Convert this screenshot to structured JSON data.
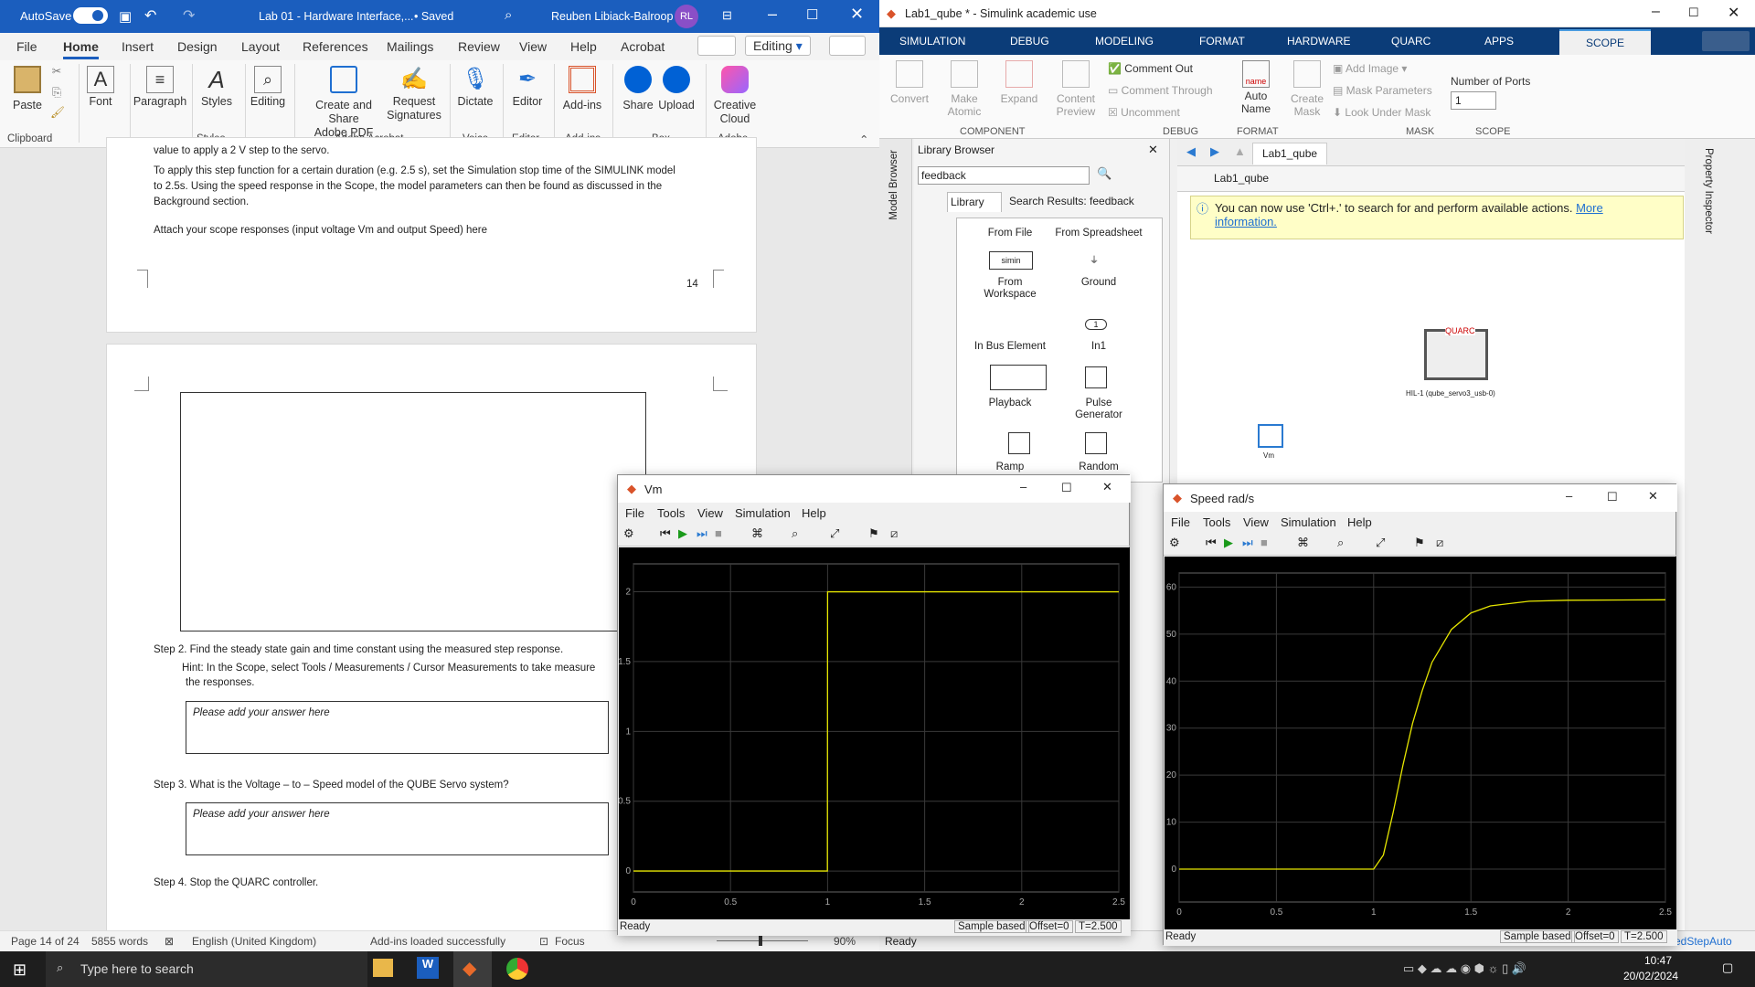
{
  "word": {
    "autosave": "AutoSave",
    "title": "Lab 01 - Hardware Interface,...",
    "saved": "• Saved",
    "user": "Reuben Libiack-Balroop",
    "avatar": "RL",
    "tabs": [
      "File",
      "Home",
      "Insert",
      "Design",
      "Layout",
      "References",
      "Mailings",
      "Review",
      "View",
      "Help",
      "Acrobat"
    ],
    "editing": "Editing",
    "ribbon": {
      "paste": "Paste",
      "font": "Font",
      "paragraph": "Paragraph",
      "styles": "Styles",
      "editing": "Editing",
      "create_pdf": "Create and Share\nAdobe PDF",
      "request_sig": "Request\nSignatures",
      "dictate": "Dictate",
      "editor": "Editor",
      "addins": "Add-ins",
      "share": "Share",
      "upload": "Upload",
      "creative": "Creative\nCloud"
    },
    "groups": {
      "clipboard": "Clipboard",
      "styles": "Styles",
      "acrobat": "Adobe Acrobat",
      "voice": "Voice",
      "editor": "Editor",
      "addins": "Add-ins",
      "box": "Box",
      "adobe": "Adobe"
    },
    "doc": {
      "l1": "value to apply a 2 V step to the servo.",
      "l2": "To apply this step function for a certain duration (e.g.  2.5 s), set the Simulation stop time of the SIMULINK model",
      "l3": "to 2.5s.  Using the speed response in the Scope, the model parameters can then be found as discussed in the",
      "l4": "Background section.",
      "l5": "Attach your scope responses (input voltage Vm and output Speed) here",
      "page_no": "14",
      "step2": "Step 2.  Find the steady state gain and time constant using the measured step response.",
      "hint": "Hint: In the Scope, select Tools / Measurements / Cursor Measurements to take measure",
      "hint2": "the responses.",
      "answer1": "Please add your answer here",
      "step3": "Step 3.  What is the Voltage – to – Speed model of the QUBE Servo system?",
      "answer2": "Please add your answer here",
      "step4": "Step 4.  Stop the QUARC controller."
    },
    "status": {
      "page": "Page 14 of 24",
      "words": "5855 words",
      "lang": "English (United Kingdom)",
      "addins": "Add-ins loaded successfully",
      "focus": "Focus",
      "zoom": "90%"
    }
  },
  "simulink": {
    "title": "Lab1_qube * - Simulink academic use",
    "tabs": [
      "SIMULATION",
      "DEBUG",
      "MODELING",
      "FORMAT",
      "HARDWARE",
      "QUARC",
      "APPS",
      "SCOPE"
    ],
    "ribbon": {
      "convert": "Convert",
      "make_atomic": "Make\nAtomic",
      "expand": "Expand",
      "content_preview": "Content\nPreview",
      "comment_out": "Comment Out",
      "comment_through": "Comment Through",
      "uncomment": "Uncomment",
      "auto_name": "Auto\nName",
      "create_mask": "Create\nMask",
      "add_image": "Add Image",
      "mask_params": "Mask Parameters",
      "look_under": "Look Under Mask",
      "num_ports": "Number of Ports",
      "ports_value": "1"
    },
    "groups": [
      "COMPONENT",
      "DEBUG",
      "FORMAT",
      "MASK",
      "SCOPE"
    ],
    "library": {
      "title": "Library Browser",
      "search": "feedback",
      "tab1": "Library",
      "tab2": "Search Results: feedback",
      "blocks": [
        "From File",
        "From Spreadsheet",
        "From\nWorkspace",
        "Ground",
        "In Bus Element",
        "In1",
        "Playback",
        "Pulse\nGenerator",
        "Ramp",
        "Random"
      ],
      "simin": "simin"
    },
    "model": {
      "tab": "Lab1_qube",
      "path": "Lab1_qube",
      "info": "You can now use 'Ctrl+.' to search for and perform available actions.",
      "info_link": "More information.",
      "hil": "HIL-1 (qube_servo3_usb-0)",
      "hil_logo": "QUARC",
      "vm": "Vm",
      "side": "Model Browser",
      "inspector": "Property Inspector"
    },
    "status": {
      "ready": "Ready",
      "solver": "edStepAuto"
    }
  },
  "scopes": [
    {
      "title": "Vm",
      "menu": [
        "File",
        "Tools",
        "View",
        "Simulation",
        "Help"
      ],
      "status": "Ready",
      "sample": "Sample based",
      "offset": "Offset=0",
      "time": "T=2.500"
    },
    {
      "title": "Speed rad/s",
      "menu": [
        "File",
        "Tools",
        "View",
        "Simulation",
        "Help"
      ],
      "status": "Ready",
      "sample": "Sample based",
      "offset": "Offset=0",
      "time": "T=2.500"
    }
  ],
  "chart_data": [
    {
      "type": "line",
      "title": "Vm",
      "x": [
        0,
        0.999,
        1.0,
        2.5
      ],
      "series": [
        {
          "values": [
            0,
            0,
            2,
            2
          ]
        }
      ],
      "xlim": [
        0,
        2.5
      ],
      "ylim": [
        -0.15,
        2.2
      ],
      "xticks": [
        "0",
        "0.5",
        "1",
        "1.5",
        "2",
        "2.5"
      ],
      "yticks": [
        "0",
        "0.5",
        "1",
        "1.5",
        "2"
      ],
      "grid": true,
      "line_color": "#e6e600"
    },
    {
      "type": "line",
      "title": "Speed rad/s",
      "x": [
        0,
        1.0,
        1.05,
        1.1,
        1.15,
        1.2,
        1.25,
        1.3,
        1.4,
        1.5,
        1.6,
        1.8,
        2.0,
        2.5
      ],
      "series": [
        {
          "values": [
            0,
            0,
            3,
            12,
            22,
            31,
            38,
            44,
            51,
            54.5,
            56,
            57,
            57.2,
            57.3
          ]
        }
      ],
      "xlim": [
        0,
        2.5
      ],
      "ylim": [
        -7,
        63
      ],
      "xticks": [
        "0",
        "0.5",
        "1",
        "1.5",
        "2",
        "2.5"
      ],
      "yticks": [
        "0",
        "10",
        "20",
        "30",
        "40",
        "50",
        "60"
      ],
      "grid": true,
      "line_color": "#e6e600"
    }
  ],
  "taskbar": {
    "search": "Type here to search",
    "time": "10:47",
    "date": "20/02/2024"
  },
  "colors": {
    "word_blue": "#1b5ebe",
    "simulink_navy": "#0b3c78",
    "trace": "#e6e600"
  }
}
